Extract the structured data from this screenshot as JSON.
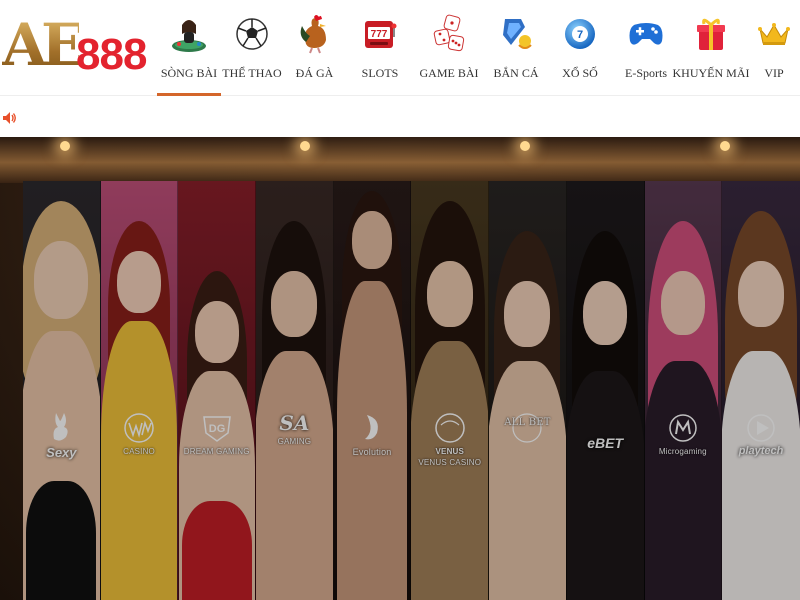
{
  "brand": {
    "logo_letters": "AE",
    "logo_number": "888"
  },
  "nav": {
    "items": [
      {
        "label": "SÒNG BÀI",
        "icon": "casino-dealer-icon",
        "active": true
      },
      {
        "label": "THỂ THAO",
        "icon": "soccer-ball-icon",
        "active": false
      },
      {
        "label": "ĐÁ GÀ",
        "icon": "rooster-icon",
        "active": false
      },
      {
        "label": "SLOTS",
        "icon": "slot-machine-icon",
        "active": false
      },
      {
        "label": "GAME BÀI",
        "icon": "dice-icon",
        "active": false
      },
      {
        "label": "BẮN CÁ",
        "icon": "fish-shooting-icon",
        "active": false
      },
      {
        "label": "XỔ SỐ",
        "icon": "lottery-ball-icon",
        "active": false
      },
      {
        "label": "E-Sports",
        "icon": "gamepad-icon",
        "active": false
      },
      {
        "label": "KHUYẾN MÃI",
        "icon": "gift-box-icon",
        "active": false
      },
      {
        "label": "VIP",
        "icon": "crown-icon",
        "active": false
      }
    ],
    "active_underline_color": "#d4662a"
  },
  "sound": {
    "icon": "speaker-icon",
    "color": "#e8502a"
  },
  "hero": {
    "providers": [
      {
        "name": "Sexy",
        "sub": ""
      },
      {
        "name": "WM",
        "sub": "CASINO"
      },
      {
        "name": "DG",
        "sub": "DREAM GAMING"
      },
      {
        "name": "SA",
        "sub": "GAMING"
      },
      {
        "name": "",
        "sub": "Evolution"
      },
      {
        "name": "VENUS",
        "sub": "VENUS CASINO"
      },
      {
        "name": "ALL BET",
        "sub": ""
      },
      {
        "name": "eBET",
        "sub": ""
      },
      {
        "name": "",
        "sub": "Microgaming"
      },
      {
        "name": "",
        "sub": "playtech"
      }
    ]
  }
}
